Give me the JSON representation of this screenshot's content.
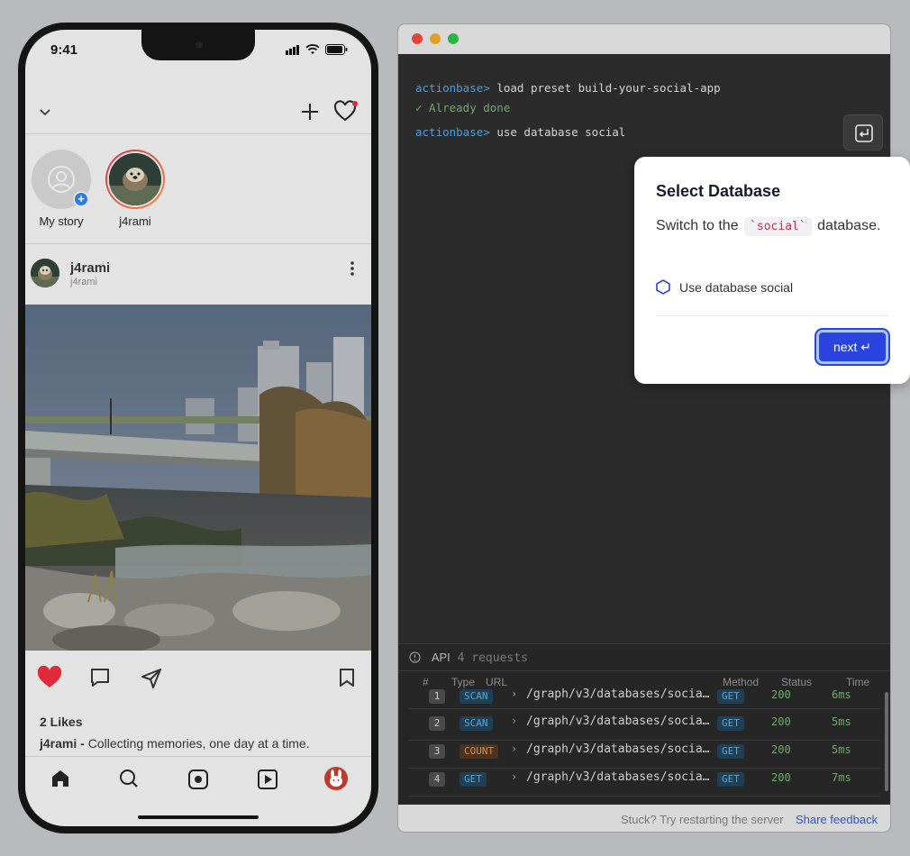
{
  "phone": {
    "status_time": "9:41",
    "stories": [
      {
        "name": "My story"
      },
      {
        "name": "j4rami"
      }
    ],
    "post": {
      "username": "j4rami",
      "handle": "j4rami",
      "likes": "2 Likes",
      "caption_user": "j4rami -",
      "caption_text": " Collecting memories, one day at a time."
    }
  },
  "terminal": {
    "lines": [
      {
        "prompt": "actionbase>",
        "command": " load preset build-your-social-app"
      },
      {
        "result": "✓ Already done"
      },
      {
        "prompt": "actionbase>",
        "command": " use database social"
      }
    ],
    "enter_icon": "enter-key-icon"
  },
  "api": {
    "title": "API",
    "count": "4 requests",
    "columns": [
      "#",
      "Type",
      "URL",
      "Method",
      "Status",
      "Time"
    ],
    "rows": [
      {
        "n": "1",
        "type": "SCAN",
        "url": "/graph/v3/databases/socia…",
        "method": "GET",
        "status": "200",
        "time": "6ms"
      },
      {
        "n": "2",
        "type": "SCAN",
        "url": "/graph/v3/databases/socia…",
        "method": "GET",
        "status": "200",
        "time": "5ms"
      },
      {
        "n": "3",
        "type": "COUNT",
        "url": "/graph/v3/databases/socia…",
        "method": "GET",
        "status": "200",
        "time": "5ms"
      },
      {
        "n": "4",
        "type": "GET",
        "url": "/graph/v3/databases/socia…",
        "method": "GET",
        "status": "200",
        "time": "7ms"
      }
    ]
  },
  "footer": {
    "hint": "Stuck? Try restarting the server",
    "link": "Share feedback"
  },
  "popover": {
    "title": "Select Database",
    "desc_before": "Switch to the",
    "desc_code": "`social`",
    "desc_after": "database.",
    "step": "Use database social",
    "next": "next ↵"
  },
  "colors": {
    "accent": "#2b44e0",
    "prompt": "#4d9fd4",
    "success": "#6eab6c",
    "like": "#e0293a"
  }
}
